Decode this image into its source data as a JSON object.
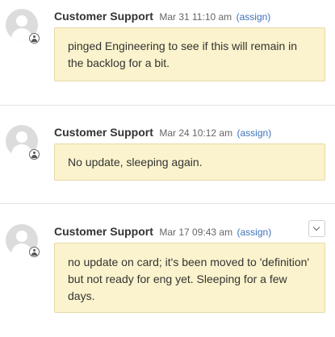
{
  "comments": [
    {
      "author": "Customer Support",
      "date": "Mar 31 11:10 am",
      "assign_label": "(assign)",
      "text": "pinged Engineering to see if this will remain in the backlog for a bit.",
      "avatar_icon": "user-avatar-icon",
      "badge_icon": "user-badge-icon"
    },
    {
      "author": "Customer Support",
      "date": "Mar 24 10:12 am",
      "assign_label": "(assign)",
      "text": "No update, sleeping again.",
      "avatar_icon": "user-avatar-icon",
      "badge_icon": "user-badge-icon"
    },
    {
      "author": "Customer Support",
      "date": "Mar 17 09:43 am",
      "assign_label": "(assign)",
      "text": "no update on card; it's been moved to 'definition' but not ready for eng yet. Sleeping for a few days.",
      "avatar_icon": "user-avatar-icon",
      "badge_icon": "user-badge-icon",
      "menu_icon": "chevron-down-icon"
    }
  ],
  "colors": {
    "note_background": "#fbf3cd",
    "note_border": "#e6d9a4",
    "link": "#3d72b8",
    "avatar": "#dcdcdc"
  }
}
